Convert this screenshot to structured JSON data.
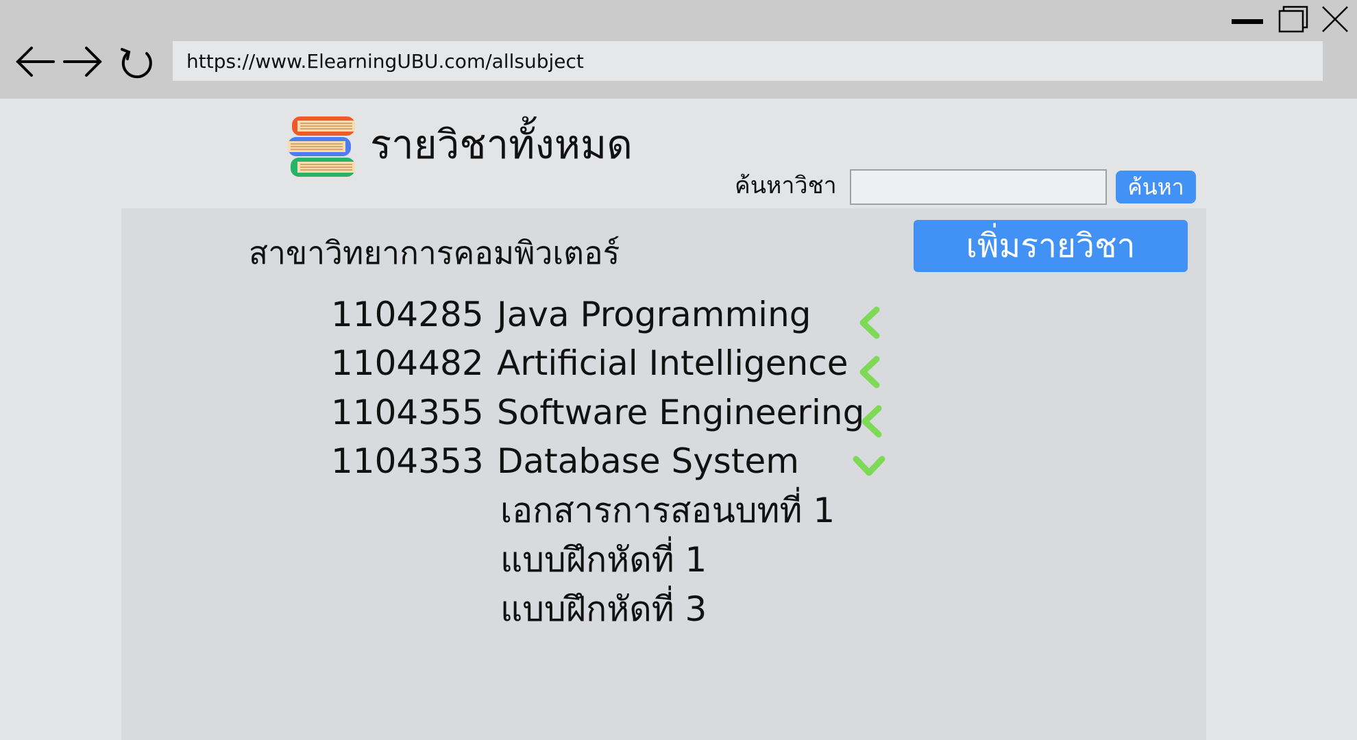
{
  "browser": {
    "url": "https://www.ElearningUBU.com/allsubject"
  },
  "header": {
    "title": "รายวิชาทั้งหมด",
    "search_label": "ค้นหาวิชา",
    "search_value": "",
    "search_button": "ค้นหา"
  },
  "department": {
    "name": "สาขาวิทยาการคอมพิวเตอร์",
    "add_button": "เพิ่มรายวิชา"
  },
  "courses": [
    {
      "code": "1104285",
      "name": "Java Programming",
      "expanded": false
    },
    {
      "code": "1104482",
      "name": "Artificial Intelligence",
      "expanded": false
    },
    {
      "code": "1104355",
      "name": "Software Engineering",
      "expanded": false
    },
    {
      "code": "1104353",
      "name": "Database System",
      "expanded": true
    }
  ],
  "course_documents": [
    "เอกสารการสอนบทที่ 1",
    "แบบฝึกหัดที่ 1",
    "แบบฝึกหัดที่ 3"
  ],
  "colors": {
    "accent": "#4291f5",
    "chevron": "#7ed957"
  }
}
